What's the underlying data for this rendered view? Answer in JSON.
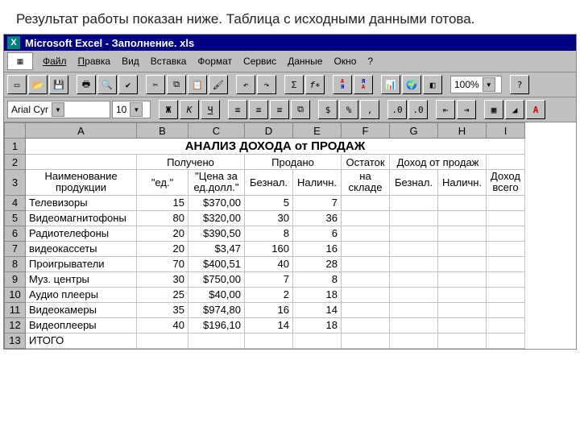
{
  "caption": "Результат  работы показан ниже. Таблица с исходными данными готова.",
  "title": "Microsoft Excel - Заполнение. xls",
  "menu": [
    "Файл",
    "Правка",
    "Вид",
    "Вставка",
    "Формат",
    "Сервис",
    "Данные",
    "Окно",
    "?"
  ],
  "zoom": "100%",
  "font": "Arial Cyr",
  "fontsize": "10",
  "btns": {
    "bold": "Ж",
    "italic": "К",
    "underline": "Ч",
    "currency": "%",
    "comma": ","
  },
  "cols": [
    "",
    "A",
    "B",
    "C",
    "D",
    "E",
    "F",
    "G",
    "H",
    "I"
  ],
  "chart_data": {
    "type": "table",
    "title": "АНАЛИЗ ДОХОДА от ПРОДАЖ",
    "groupHeaders": {
      "received": "Получено",
      "sold": "Продано",
      "stock": "Остаток",
      "income": "Доход от продаж"
    },
    "subHeaders": {
      "name": "Наименование продукции",
      "qty": "\"ед.\"",
      "price": "\"Цена за ед.долл.\"",
      "cashless": "Безнал.",
      "cash": "Наличн.",
      "stock": "на складе",
      "cashless2": "Безнал.",
      "cash2": "Наличн.",
      "total": "Доход всего"
    },
    "rows": [
      {
        "n": "Телевизоры",
        "q": 15,
        "p": "$370,00",
        "bn": 5,
        "ca": 7
      },
      {
        "n": "Видеомагнитофоны",
        "q": 80,
        "p": "$320,00",
        "bn": 30,
        "ca": 36
      },
      {
        "n": "Радиотелефоны",
        "q": 20,
        "p": "$390,50",
        "bn": 8,
        "ca": 6
      },
      {
        "n": "видеокассеты",
        "q": 20,
        "p": "$3,47",
        "bn": 160,
        "ca": 16
      },
      {
        "n": "Проигрыватели",
        "q": 70,
        "p": "$400,51",
        "bn": 40,
        "ca": 28
      },
      {
        "n": "Муз. центры",
        "q": 30,
        "p": "$750,00",
        "bn": 7,
        "ca": 8
      },
      {
        "n": "Аудио плееры",
        "q": 25,
        "p": "$40,00",
        "bn": 2,
        "ca": 18
      },
      {
        "n": "Видеокамеры",
        "q": 35,
        "p": "$974,80",
        "bn": 16,
        "ca": 14
      },
      {
        "n": "Видеоплееры",
        "q": 40,
        "p": "$196,10",
        "bn": 14,
        "ca": 18
      }
    ],
    "totalLabel": "ИТОГО"
  }
}
